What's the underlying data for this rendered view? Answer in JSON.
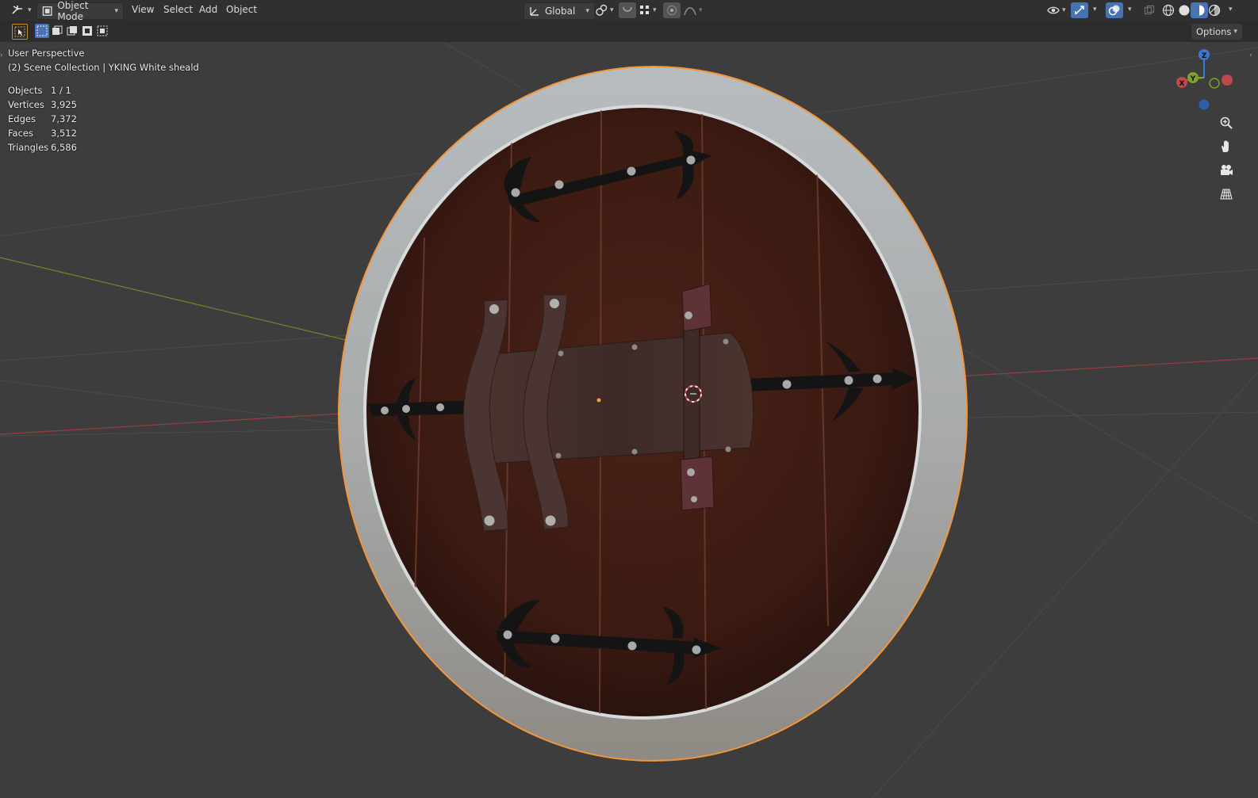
{
  "header": {
    "mode_label": "Object Mode",
    "menus": [
      "View",
      "Select",
      "Add",
      "Object"
    ],
    "transform_orientation": "Global"
  },
  "toolbar2": {
    "options_label": "Options"
  },
  "viewport": {
    "view_name": "User Perspective",
    "collection_info": "(2) Scene Collection | YKING White sheald",
    "stats": [
      {
        "label": "Objects",
        "value": "1 / 1"
      },
      {
        "label": "Vertices",
        "value": "3,925"
      },
      {
        "label": "Edges",
        "value": "7,372"
      },
      {
        "label": "Faces",
        "value": "3,512"
      },
      {
        "label": "Triangles",
        "value": "6,586"
      }
    ],
    "gizmo": {
      "x": "X",
      "y": "Y",
      "z": "Z"
    }
  },
  "colors": {
    "header_bg": "#303030",
    "viewport_bg": "#3d3d3d",
    "active_blue": "#4772b3",
    "selection_orange": "#f5953a",
    "axis_x": "#c0474b",
    "axis_y": "#7aa22d",
    "axis_z": "#3b78d4"
  },
  "icons": [
    "editor-type-icon",
    "object-mode-icon",
    "orientation-icon",
    "pivot-icon",
    "snap-icon",
    "snap-increment-icon",
    "proportional-edit-icon",
    "falloff-icon",
    "visibility-icon",
    "gizmo-icon",
    "overlay-icon",
    "xray-icon",
    "wireframe-shading-icon",
    "solid-shading-icon",
    "material-shading-icon",
    "rendered-shading-icon",
    "select-tool-icon",
    "zoom-icon",
    "pan-hand-icon",
    "camera-icon",
    "perspective-grid-icon"
  ]
}
